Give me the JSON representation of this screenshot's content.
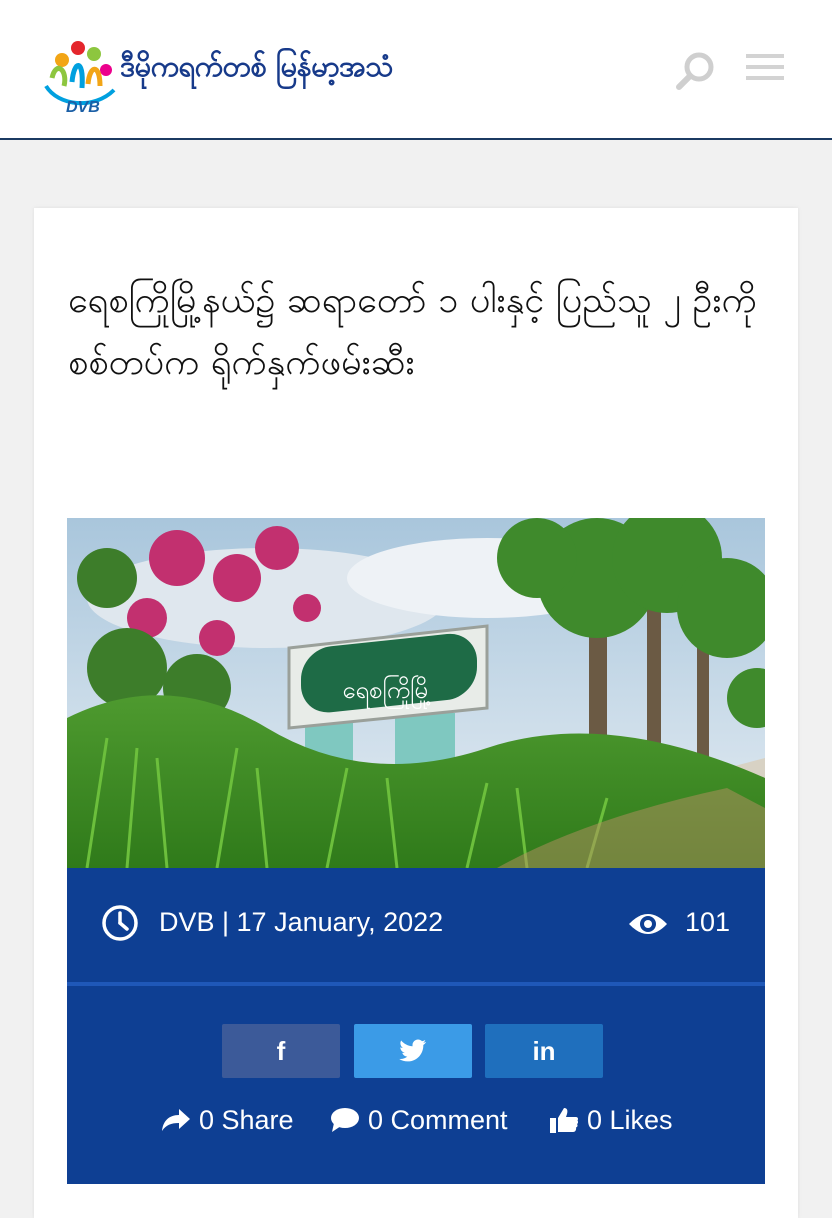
{
  "header": {
    "site_name": "ဒီမိုကရက်တစ် မြန်မာ့အသံ",
    "logo_text": "DVB",
    "icons": [
      "search-icon",
      "menu-icon"
    ]
  },
  "article": {
    "headline": "ရေစကြိုမြို့နယ်၌ ဆရာတော် ၁ ပါးနှင့် ပြည်သူ ၂ ဦးကို စစ်တပ်က ရိုက်နှက်ဖမ်းဆီး",
    "image_sign_text": "ရေစကြိုမြို့",
    "byline": "DVB | 17 January, 2022",
    "views": "101"
  },
  "share_buttons": [
    {
      "label": "f",
      "network": "facebook",
      "color": "#3c5a99"
    },
    {
      "label": "twitter-bird",
      "network": "twitter",
      "color": "#3b9be7"
    },
    {
      "label": "in",
      "network": "linkedin",
      "color": "#1f6fbd"
    }
  ],
  "stats": {
    "share": "0 Share",
    "comment": "0 Comment",
    "likes": "0 Likes"
  },
  "colors": {
    "brand_blue": "#0e3f93",
    "header_border": "#1b3a62",
    "site_name": "#173a8a"
  }
}
